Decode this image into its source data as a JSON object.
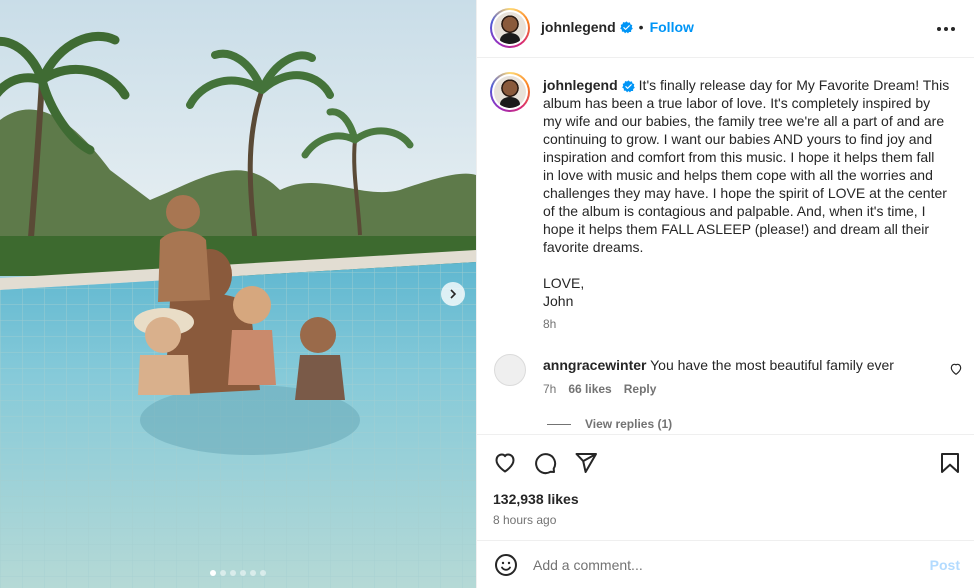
{
  "post": {
    "author": "johnlegend",
    "follow_label": "Follow",
    "separator": "•",
    "caption_lines": [
      "It's finally release day for My Favorite Dream! This",
      "album has been a true labor of love. It's completely inspired by",
      "my wife and our babies, the family tree we're all a part of and are",
      "continuing to grow. I want our babies AND yours to find joy and",
      "inspiration and comfort from this music. I hope it helps them fall",
      "in love with music and helps them cope with all the worries and",
      "challenges they may have. I hope the spirit of LOVE at the center",
      "of the album is contagious and palpable. And, when it's time, I",
      "hope it helps them FALL ASLEEP (please!) and dream all their",
      "favorite dreams.",
      "",
      "LOVE,",
      "John"
    ],
    "caption_time": "8h",
    "likes": "132,938 likes",
    "posted": "8 hours ago",
    "carousel": {
      "count": 6,
      "active_index": 0
    }
  },
  "comment": {
    "author": "anngracewinter",
    "text": "You have the most beautiful family ever",
    "time": "7h",
    "likes": "66 likes",
    "reply_label": "Reply",
    "view_replies": "View replies (1)"
  },
  "compose": {
    "placeholder": "Add a comment...",
    "post_label": "Post"
  },
  "icons": {
    "verified": "verified-badge-icon",
    "more": "more-options-icon",
    "heart": "heart-icon",
    "comment": "comment-icon",
    "share": "share-icon",
    "save": "bookmark-icon",
    "emoji": "emoji-icon",
    "next": "chevron-right-icon"
  },
  "colors": {
    "accent": "#0095f6",
    "text": "#262626",
    "muted": "#737373",
    "border": "#efefef",
    "post_disabled": "#b3dbff"
  }
}
